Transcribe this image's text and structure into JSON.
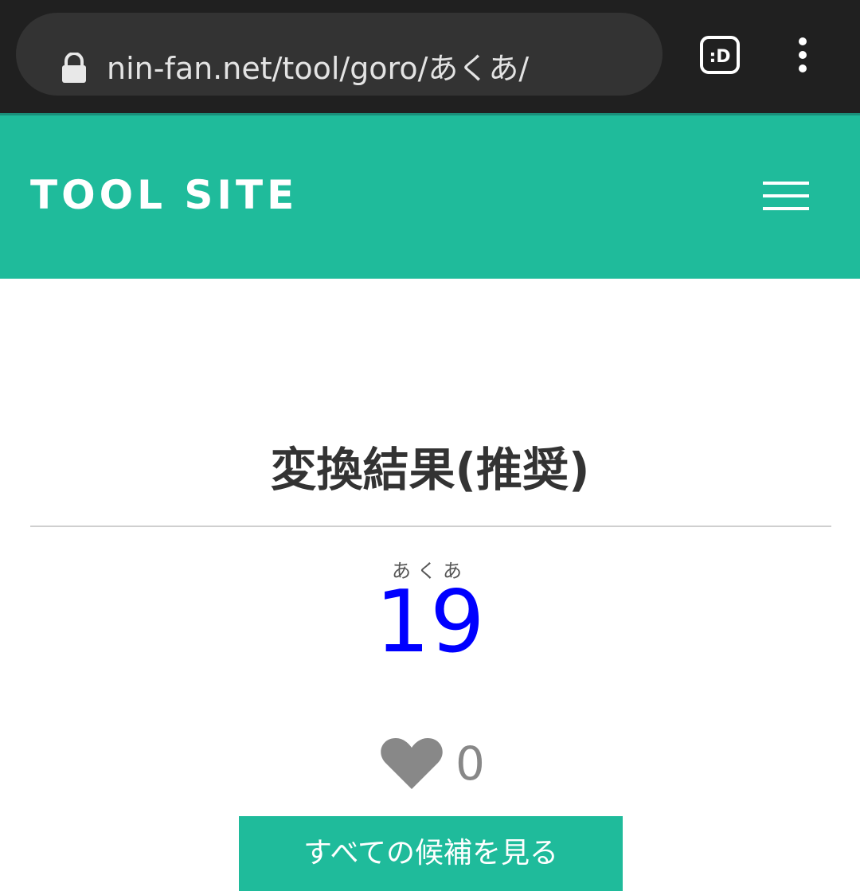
{
  "browser": {
    "url": "nin-fan.net/tool/goro/あくあ/",
    "icons": [
      "lock-icon",
      "reader-mode-icon",
      "more-vertical-icon"
    ]
  },
  "header": {
    "site_title": "TOOL SITE",
    "menu_icon": "hamburger-icon",
    "background_color": "#1fbb9b"
  },
  "main": {
    "section_title": "変換結果(推奨)",
    "result": {
      "reading": "あくあ",
      "number": "19",
      "number_color": "#0000ff"
    },
    "likes": {
      "icon": "heart-icon",
      "count": "0"
    },
    "button_label": "すべての候補を見る"
  }
}
